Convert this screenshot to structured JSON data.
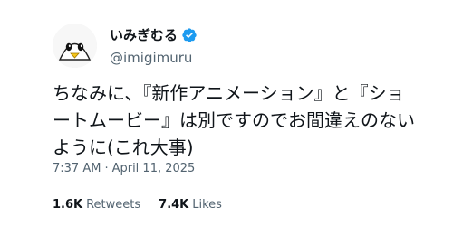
{
  "tweet": {
    "author": {
      "display_name": "いみぎむる",
      "handle": "@imigimuru",
      "verified": true,
      "avatar_icon": "penguin-avatar-icon",
      "verified_icon": "verified-badge-icon",
      "verified_color": "#1d9bf0"
    },
    "text": "ちなみに、『新作アニメーション』と『ショートムービー』は別ですのでお間違えのないように(これ大事)",
    "time": "7:37 AM",
    "separator": "·",
    "date": "April 11, 2025",
    "stats": {
      "retweets_count": "1.6K",
      "retweets_label": "Retweets",
      "likes_count": "7.4K",
      "likes_label": "Likes"
    }
  }
}
